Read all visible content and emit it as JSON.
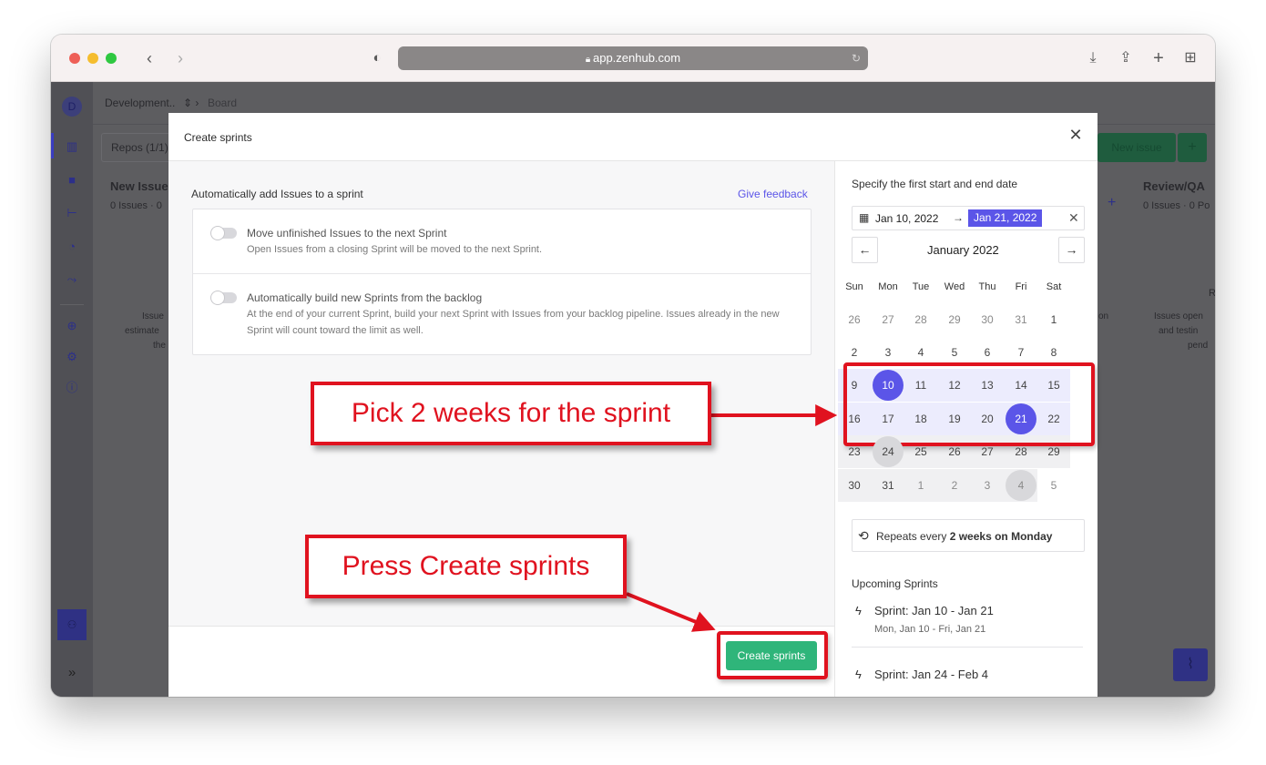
{
  "browser": {
    "url": "app.zenhub.com"
  },
  "background": {
    "workspace_avatar": "D",
    "breadcrumb_workspace": "Development..",
    "breadcrumb_board": "Board",
    "repos_label": "Repos (1/1)",
    "new_issue_label": "New issue",
    "col_new_issues": "New Issue",
    "col_new_issues_count": "0 Issues · 0",
    "col_review": "Review/QA",
    "col_review_count": "0 Issues · 0 Po",
    "side_text_a": "Issue",
    "side_text_b": "estimate",
    "side_text_c": "the",
    "right_text_a": "R",
    "right_text_b": "Issues open",
    "right_text_c": "and testin",
    "right_text_d": "pend",
    "right_text_e": "on"
  },
  "modal": {
    "title": "Create sprints",
    "section_title": "Automatically add Issues to a sprint",
    "feedback_link": "Give feedback",
    "options": [
      {
        "title": "Move unfinished Issues to the next Sprint",
        "description": "Open Issues from a closing Sprint will be moved to the next Sprint."
      },
      {
        "title": "Automatically build new Sprints from the backlog",
        "description": "At the end of your current Sprint, build your next Sprint with Issues from your backlog pipeline. Issues already in the new Sprint will count toward the limit as well."
      }
    ],
    "create_button": "Create sprints"
  },
  "calendar": {
    "heading": "Specify the first start and end date",
    "start_date": "Jan 10, 2022",
    "end_date": "Jan 21, 2022",
    "month_label": "January 2022",
    "weekdays": [
      "Sun",
      "Mon",
      "Tue",
      "Wed",
      "Thu",
      "Fri",
      "Sat"
    ],
    "weeks": [
      [
        "26",
        "27",
        "28",
        "29",
        "30",
        "31",
        "1"
      ],
      [
        "2",
        "3",
        "4",
        "5",
        "6",
        "7",
        "8"
      ],
      [
        "9",
        "10",
        "11",
        "12",
        "13",
        "14",
        "15"
      ],
      [
        "16",
        "17",
        "18",
        "19",
        "20",
        "21",
        "22"
      ],
      [
        "23",
        "24",
        "25",
        "26",
        "27",
        "28",
        "29"
      ],
      [
        "30",
        "31",
        "1",
        "2",
        "3",
        "4",
        "5"
      ]
    ],
    "selected_start": "10",
    "selected_end": "21",
    "repeat_prefix": "Repeats every",
    "repeat_bold": "2 weeks on Monday",
    "upcoming_title": "Upcoming Sprints",
    "sprints": [
      {
        "name": "Sprint: Jan 10 - Jan 21",
        "dates": "Mon, Jan 10 - Fri, Jan 21"
      },
      {
        "name": "Sprint: Jan 24 - Feb 4",
        "dates": ""
      }
    ],
    "accent_color": "#5b55e8"
  },
  "annotations": {
    "callout_1": "Pick 2 weeks for the sprint",
    "callout_2": "Press Create sprints",
    "color": "#e0121f"
  }
}
